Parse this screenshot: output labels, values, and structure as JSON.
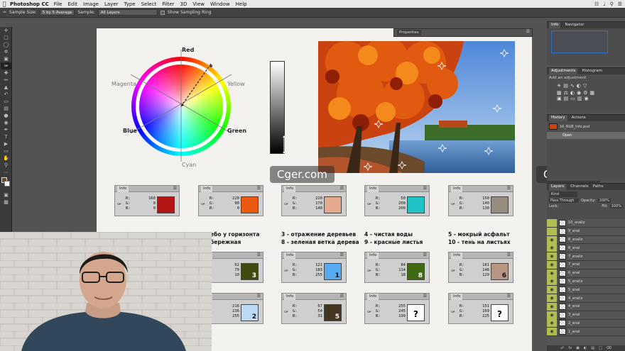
{
  "menubar": {
    "app_name": "Photoshop CC",
    "items": [
      "File",
      "Edit",
      "Image",
      "Layer",
      "Type",
      "Select",
      "Filter",
      "3D",
      "View",
      "Window",
      "Help"
    ]
  },
  "options": {
    "sample_size_label": "Sample Size:",
    "sample_size_value": "5 by 5 Average",
    "sample_label": "Sample:",
    "sample_value": "All Layers",
    "ring_label": "Show Sampling Ring"
  },
  "wheel": {
    "labels": {
      "red": "Red",
      "yellow": "Yellow",
      "green": "Green",
      "cyan": "Cyan",
      "blue": "Blue",
      "magenta": "Magenta"
    }
  },
  "properties_label": "Properties",
  "info_panels": {
    "tab_label": "Info",
    "row1": [
      {
        "r": "160",
        "g": "0",
        "b": "0",
        "color": "#b31414"
      },
      {
        "r": "220",
        "g": "90",
        "b": "0",
        "color": "#e9590f"
      },
      {
        "r": "220",
        "g": "170",
        "b": "140",
        "color": "#e4a88c"
      },
      {
        "r": "50",
        "g": "200",
        "b": "200",
        "color": "#21c2c5"
      },
      {
        "r": "150",
        "g": "140",
        "b": "130",
        "color": "#968c82"
      }
    ],
    "row2": [
      {
        "r": "62",
        "g": "70",
        "b": "10",
        "color": "#3e4a0e",
        "num": "3"
      },
      {
        "r": "121",
        "g": "183",
        "b": "255",
        "color": "#55aaf0",
        "num": "1"
      },
      {
        "r": "84",
        "g": "114",
        "b": "18",
        "color": "#3f6a12",
        "num": "8"
      },
      {
        "r": "181",
        "g": "148",
        "b": "129",
        "color": "#b79683",
        "num": "6"
      }
    ],
    "row3": [
      {
        "r": "216",
        "g": "236",
        "b": "255",
        "color": "#bcd9f2",
        "num": "2"
      },
      {
        "r": "67",
        "g": "54",
        "b": "31",
        "color": "#453621",
        "num": "5"
      },
      {
        "r": "255",
        "g": "245",
        "b": "199",
        "color": "#ffffff",
        "num": "?"
      },
      {
        "r": "151",
        "g": "169",
        "b": "225",
        "color": "#ffffff",
        "num": "?"
      }
    ]
  },
  "captions": {
    "c1a": "ебо у горизонта",
    "c1b": "бережная",
    "c2a": "3 - отражение деревьев",
    "c2b": "8 - зеленая ветка дерева",
    "c3a": "4 - чистая воды",
    "c3b": "9 - красные листья",
    "c4a": "5 - мокрый асфальт",
    "c4b": "10 - тень на листьях"
  },
  "watermark": "Cger.com",
  "right_panels": {
    "info_tabs": [
      "Info",
      "Navigator"
    ],
    "adjustments_tabs": [
      "Adjustments",
      "Histogram"
    ],
    "adjustments_hint": "Add an adjustment",
    "history_tabs": [
      "History",
      "Actions"
    ],
    "history_file": "16_RGB_Info.psd",
    "history_open": "Open",
    "layers_tabs": [
      "Layers",
      "Channels",
      "Paths"
    ],
    "kind": "Kind",
    "blend": "Pass Through",
    "opacity_label": "Opacity:",
    "opacity_value": "100%",
    "lock_label": "Lock:",
    "fill_label": "Fill:",
    "fill_value": "100%",
    "layers": [
      "10_analiz",
      "9_anal",
      "8_analiz",
      "8_anal",
      "7_analiz",
      "7_anal",
      "6_anal",
      "5_analiz",
      "5_anal",
      "4_analiz",
      "4_anal",
      "3_anal",
      "2_anal",
      "1_anal"
    ]
  }
}
